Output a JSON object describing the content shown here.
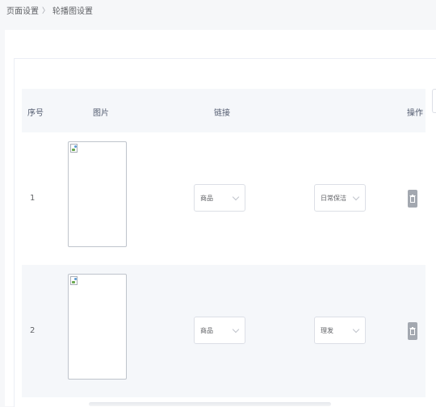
{
  "breadcrumb": {
    "parent": "页面设置",
    "separator": "〉",
    "current": "轮播图设置"
  },
  "table": {
    "headers": {
      "index": "序号",
      "image": "图片",
      "link": "链接",
      "action": "操作"
    },
    "rows": [
      {
        "index": "1",
        "link_type": "商品",
        "link_target": "日常保洁"
      },
      {
        "index": "2",
        "link_type": "商品",
        "link_target": "理发"
      }
    ]
  },
  "icons": {
    "row_image": "broken-image-icon",
    "delete": "trash-icon",
    "select_arrow": "chevron-down-icon"
  },
  "colors": {
    "header_bg": "#f5f7fa",
    "delete_button": "#a3a8b0",
    "border": "#dcdfe6"
  }
}
